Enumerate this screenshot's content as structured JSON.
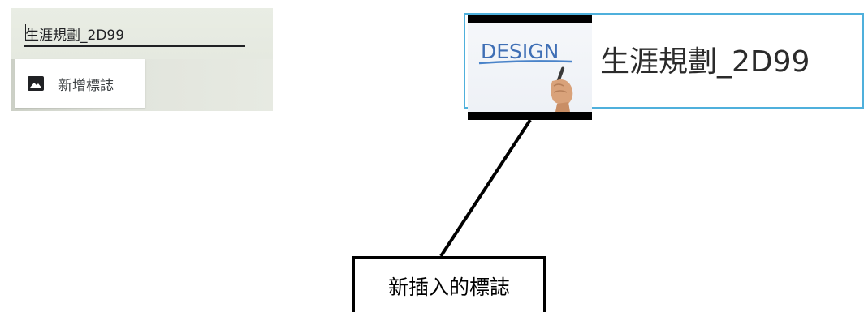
{
  "left_panel": {
    "site_name_value": "生涯規劃_2D99",
    "add_logo_label": "新增標誌"
  },
  "logo_preview": {
    "logo_text": "DESIGN",
    "site_title": "生涯規劃_2D99",
    "border_color": "#4fb0dc"
  },
  "callout": {
    "label": "新插入的標誌"
  },
  "icons": [
    "image-icon",
    "hand-marker-icon"
  ]
}
